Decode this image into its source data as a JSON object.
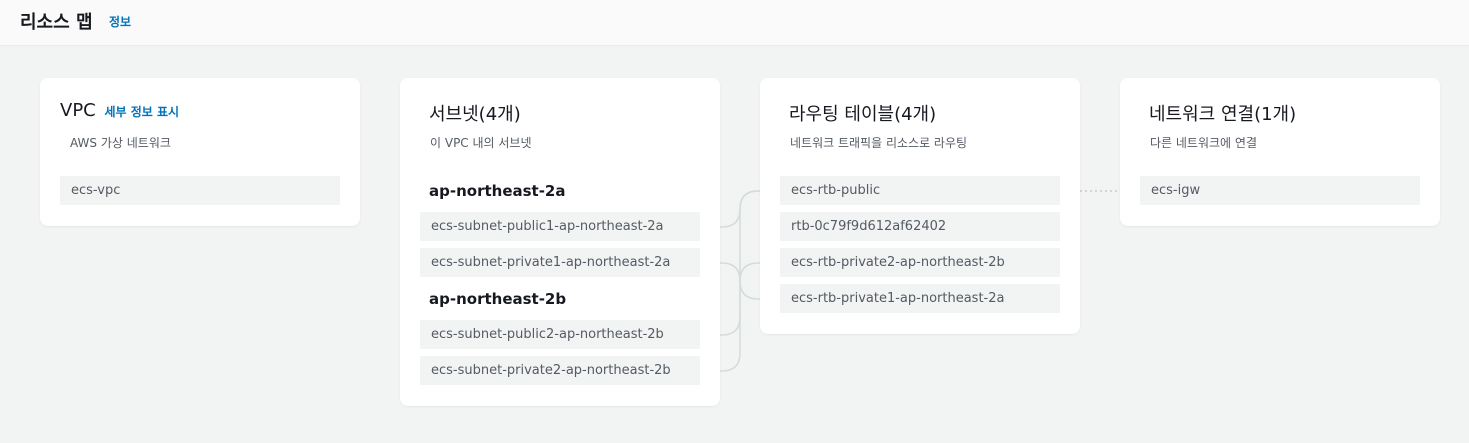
{
  "header": {
    "title": "리소스 맵",
    "info_link": "정보"
  },
  "vpc": {
    "title": "VPC",
    "details_link": "세부 정보 표시",
    "subtitle": "AWS 가상 네트워크",
    "items": [
      "ecs-vpc"
    ]
  },
  "subnets": {
    "title": "서브넷(4개)",
    "subtitle": "이 VPC 내의 서브넷",
    "groups": [
      {
        "az": "ap-northeast-2a",
        "items": [
          "ecs-subnet-public1-ap-northeast-2a",
          "ecs-subnet-private1-ap-northeast-2a"
        ]
      },
      {
        "az": "ap-northeast-2b",
        "items": [
          "ecs-subnet-public2-ap-northeast-2b",
          "ecs-subnet-private2-ap-northeast-2b"
        ]
      }
    ]
  },
  "route_tables": {
    "title": "라우팅 테이블(4개)",
    "subtitle": "네트워크 트래픽을 리소스로 라우팅",
    "items": [
      "ecs-rtb-public",
      "rtb-0c79f9d612af62402",
      "ecs-rtb-private2-ap-northeast-2b",
      "ecs-rtb-private1-ap-northeast-2a"
    ]
  },
  "network_connections": {
    "title": "네트워크 연결(1개)",
    "subtitle": "다른 네트워크에 연결",
    "items": [
      "ecs-igw"
    ]
  },
  "colors": {
    "background": "#f2f3f3",
    "card": "#ffffff",
    "link": "#0073bb",
    "item_bg": "#f2f3f3",
    "connector": "#d5dbdb"
  }
}
